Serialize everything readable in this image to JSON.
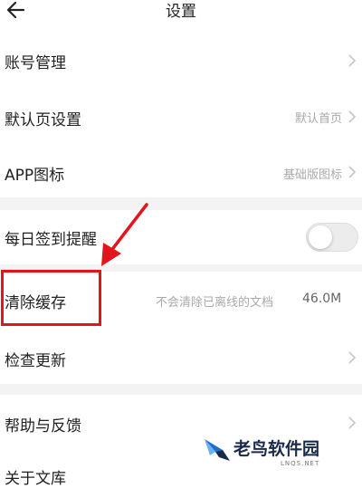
{
  "header": {
    "title": "设置",
    "back_icon": "arrow-left-icon"
  },
  "rows": [
    {
      "label": "账号管理",
      "value": ""
    },
    {
      "label": "默认页设置",
      "value": "默认首页"
    },
    {
      "label": "APP图标",
      "value": "基础版图标"
    },
    {
      "label": "每日签到提醒",
      "value": "",
      "toggle_on": false
    },
    {
      "label": "清除缓存",
      "value": "不会清除已离线的文档",
      "size": "46.0M"
    },
    {
      "label": "检查更新",
      "value": ""
    },
    {
      "label": "帮助与反馈",
      "value": ""
    },
    {
      "label": "关于文库",
      "value": ""
    }
  ],
  "watermark": {
    "text": "老鸟软件园",
    "sub": "LNQS.NET"
  },
  "colors": {
    "annotation": "#e3141b",
    "separator": "#f3f3f3",
    "value_text": "#aaaaaa"
  }
}
